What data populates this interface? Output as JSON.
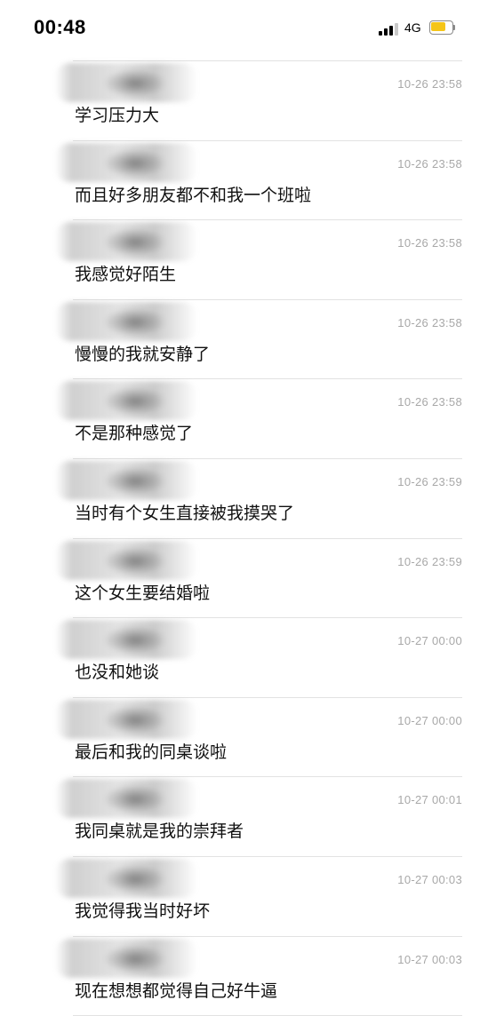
{
  "status_bar": {
    "time": "00:48",
    "network": "4G",
    "signal_bars_active": 3,
    "signal_bars_total": 4,
    "battery_level": 0.75,
    "battery_color": "#f5c518"
  },
  "messages": [
    {
      "timestamp": "10-26 23:58",
      "text": "学习压力大"
    },
    {
      "timestamp": "10-26 23:58",
      "text": "而且好多朋友都不和我一个班啦"
    },
    {
      "timestamp": "10-26 23:58",
      "text": "我感觉好陌生"
    },
    {
      "timestamp": "10-26 23:58",
      "text": "慢慢的我就安静了"
    },
    {
      "timestamp": "10-26 23:58",
      "text": "不是那种感觉了"
    },
    {
      "timestamp": "10-26 23:59",
      "text": "当时有个女生直接被我摸哭了"
    },
    {
      "timestamp": "10-26 23:59",
      "text": "这个女生要结婚啦"
    },
    {
      "timestamp": "10-27 00:00",
      "text": "也没和她谈"
    },
    {
      "timestamp": "10-27 00:00",
      "text": "最后和我的同桌谈啦"
    },
    {
      "timestamp": "10-27 00:01",
      "text": "我同桌就是我的崇拜者"
    },
    {
      "timestamp": "10-27 00:03",
      "text": "我觉得我当时好坏"
    },
    {
      "timestamp": "10-27 00:03",
      "text": "现在想想都觉得自己好牛逼"
    }
  ]
}
